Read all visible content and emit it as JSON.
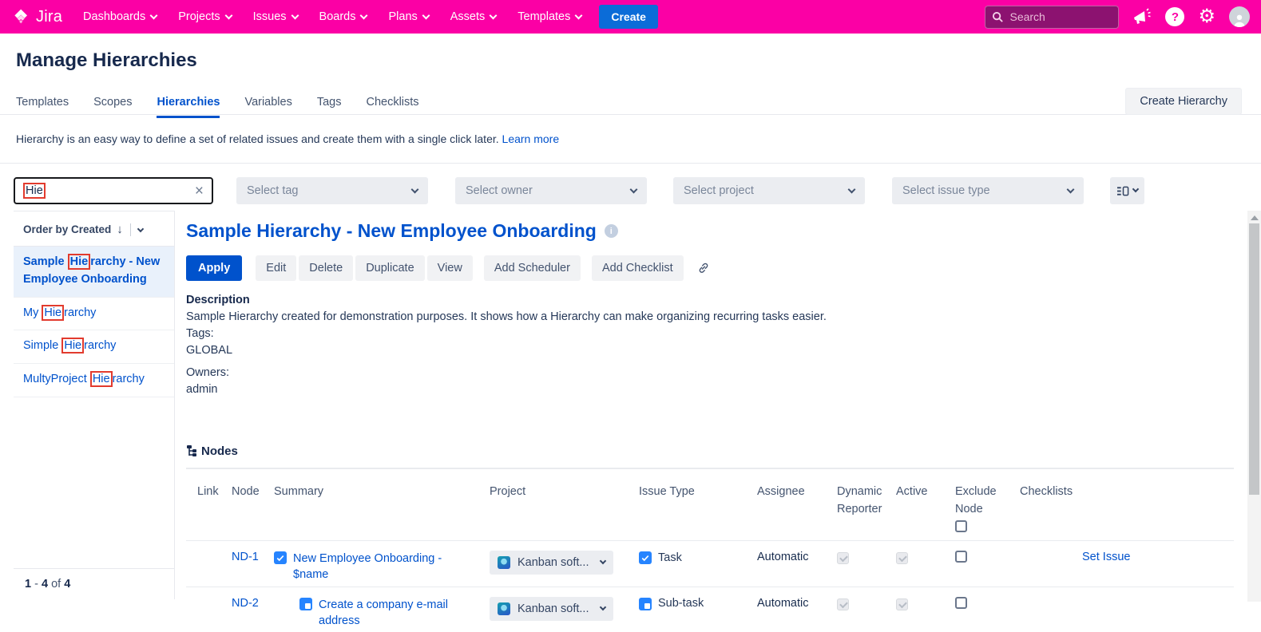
{
  "colors": {
    "nav_pink": "#fb00a5",
    "primary_blue": "#0052CC",
    "create_blue": "#0b6cd8",
    "highlight_red": "#e23b2e",
    "issue_icon_blue": "#2684FF"
  },
  "nav": {
    "logo_text": "Jira",
    "items": [
      "Dashboards",
      "Projects",
      "Issues",
      "Boards",
      "Plans",
      "Assets",
      "Templates"
    ],
    "create_label": "Create",
    "search_placeholder": "Search"
  },
  "page": {
    "title": "Manage Hierarchies"
  },
  "tabs": {
    "items": [
      "Templates",
      "Scopes",
      "Hierarchies",
      "Variables",
      "Tags",
      "Checklists"
    ],
    "create_button": "Create Hierarchy"
  },
  "intro": {
    "text": "Hierarchy is an easy way to define a set of related issues and create them with a single click later.",
    "link": "Learn more"
  },
  "filters": {
    "search_value": "Hie",
    "select_tag": "Select tag",
    "select_owner": "Select owner",
    "select_project": "Select project",
    "select_issue_type": "Select issue type"
  },
  "sidebar": {
    "order_label": "Order by Created",
    "order_arrow": "↓",
    "items": [
      {
        "pre": "Sample ",
        "match": "Hie",
        "post": "rarchy - New Employee Onboarding"
      },
      {
        "pre": "My ",
        "match": "Hie",
        "post": "rarchy"
      },
      {
        "pre": "Simple ",
        "match": "Hie",
        "post": "rarchy"
      },
      {
        "pre": "MultyProject ",
        "match": "Hie",
        "post": "rarchy"
      }
    ],
    "pagination": {
      "from": "1",
      "dash": "-",
      "to": "4",
      "of": "of",
      "total": "4"
    }
  },
  "detail": {
    "title": "Sample Hierarchy - New Employee Onboarding",
    "buttons": {
      "apply": "Apply",
      "edit": "Edit",
      "delete": "Delete",
      "duplicate": "Duplicate",
      "view": "View",
      "add_scheduler": "Add Scheduler",
      "add_checklist": "Add Checklist"
    },
    "description_label": "Description",
    "description": "Sample Hierarchy created for demonstration purposes. It shows how a Hierarchy can make organizing recurring tasks easier.",
    "tags_label": "Tags:",
    "tags_value": "GLOBAL",
    "owners_label": "Owners:",
    "owners_value": "admin"
  },
  "nodes": {
    "title": "Nodes",
    "headers": {
      "link": "Link",
      "node": "Node",
      "summary": "Summary",
      "project": "Project",
      "issue_type": "Issue Type",
      "assignee": "Assignee",
      "dynamic_reporter": "Dynamic Reporter",
      "active": "Active",
      "exclude_node": "Exclude Node",
      "checklists": "Checklists"
    },
    "rows": [
      {
        "node": "ND-1",
        "summary": "New Employee Onboarding - $name",
        "project": "Kanban soft...",
        "issue_type": "Task",
        "assignee": "Automatic",
        "checklist_link": "Set Issue"
      },
      {
        "node": "ND-2",
        "summary": "Create a company e-mail address",
        "project": "Kanban soft...",
        "issue_type": "Sub-task",
        "assignee": "Automatic",
        "checklist_link": ""
      }
    ]
  }
}
